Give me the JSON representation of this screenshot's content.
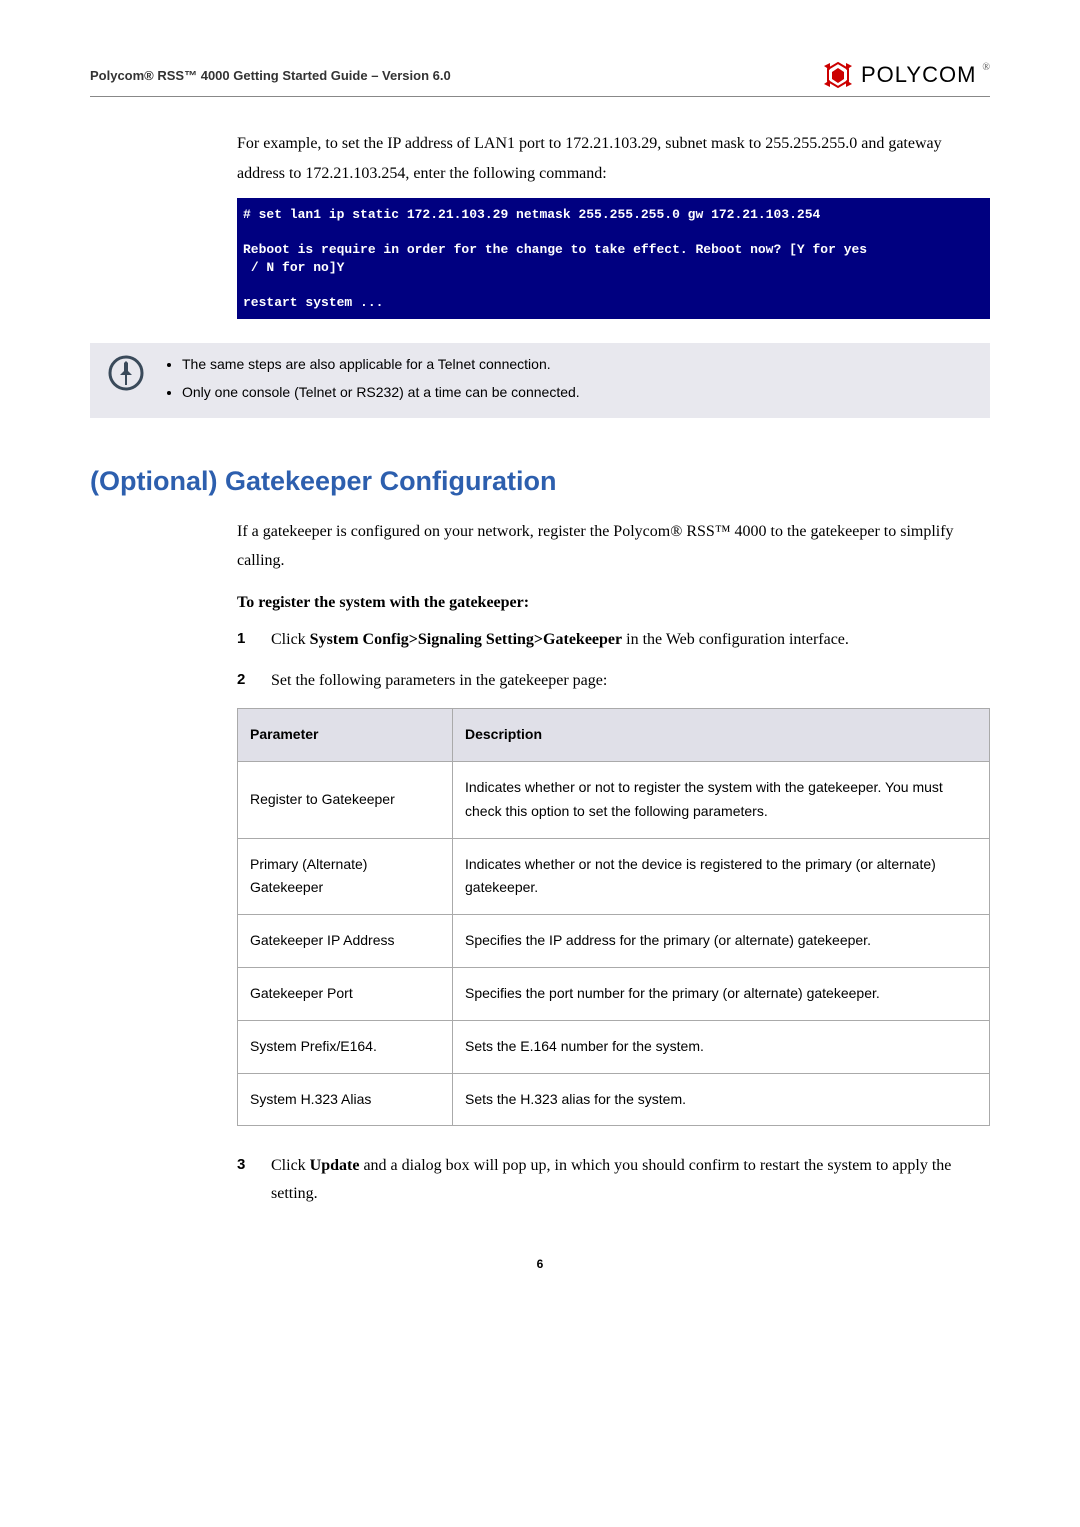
{
  "header": {
    "title": "Polycom® RSS™ 4000 Getting Started Guide – Version 6.0",
    "brand": "POLYCOM"
  },
  "intro_paragraph": "For example, to set the IP address of LAN1 port to 172.21.103.29, subnet mask to 255.255.255.0 and gateway address to 172.21.103.254, enter the following command:",
  "console_text": "# set lan1 ip static 172.21.103.29 netmask 255.255.255.0 gw 172.21.103.254\n\nReboot is require in order for the change to take effect. Reboot now? [Y for yes\n / N for no]Y\n\nrestart system ...",
  "note_items": [
    "The same steps are also applicable for a Telnet connection.",
    "Only one console (Telnet or RS232) at a time can be connected."
  ],
  "section_heading": "(Optional) Gatekeeper Configuration",
  "section_intro": "If a gatekeeper is configured on your network, register the Polycom® RSS™ 4000 to the gatekeeper to simplify calling.",
  "sub_heading": "To register the system with the gatekeeper:",
  "step1_prefix": "Click ",
  "step1_bold": "System Config>Signaling Setting>Gatekeeper",
  "step1_suffix": " in the Web configuration interface.",
  "step2_text": "Set the following parameters in the gatekeeper page:",
  "table": {
    "head_param": "Parameter",
    "head_desc": "Description",
    "rows": [
      {
        "param": "Register to Gatekeeper",
        "desc": "Indicates whether or not to register the system with the gatekeeper. You must check this option to set the following parameters."
      },
      {
        "param": "Primary (Alternate) Gatekeeper",
        "desc": "Indicates whether or not the device is registered to the primary (or alternate) gatekeeper."
      },
      {
        "param": "Gatekeeper IP Address",
        "desc": "Specifies the IP address for the primary (or alternate) gatekeeper."
      },
      {
        "param": "Gatekeeper Port",
        "desc": "Specifies the port number for the primary (or alternate) gatekeeper."
      },
      {
        "param": "System Prefix/E164.",
        "desc": "Sets the E.164 number for the system."
      },
      {
        "param": "System H.323 Alias",
        "desc": "Sets the H.323 alias for the system."
      }
    ]
  },
  "step3_prefix": "Click ",
  "step3_bold": "Update",
  "step3_suffix": " and a dialog box will pop up, in which you should confirm to restart the system to apply the setting.",
  "page_number": "6"
}
